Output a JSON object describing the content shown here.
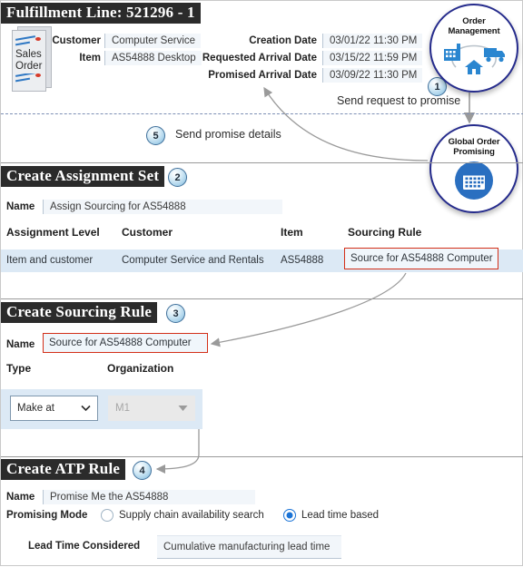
{
  "fulfillment": {
    "title": "Fulfillment Line: 521296 - 1",
    "doc_icon_label_line1": "Sales",
    "doc_icon_label_line2": "Order",
    "left_fields": [
      {
        "label": "Customer",
        "value": "Computer Service"
      },
      {
        "label": "Item",
        "value": "AS54888 Desktop"
      }
    ],
    "right_fields": [
      {
        "label": "Creation Date",
        "value": "03/01/22 11:30 PM"
      },
      {
        "label": "Requested Arrival Date",
        "value": "03/15/22 11:59 PM"
      },
      {
        "label": "Promised Arrival Date",
        "value": "03/09/22 11:30 PM"
      }
    ]
  },
  "steps": {
    "step1_number": "1",
    "step1_label": "Send request to promise",
    "step5_number": "5",
    "step5_label": "Send promise details"
  },
  "circles": {
    "order_management": {
      "line1": "Order",
      "line2": "Management",
      "icons": [
        "factory-icon",
        "truck-icon",
        "house-icon"
      ]
    },
    "global_order_promising": {
      "line1": "Global Order",
      "line2": "Promising",
      "icons": [
        "calendar-icon"
      ]
    }
  },
  "assignment_set": {
    "heading": "Create Assignment Set",
    "badge": "2",
    "name_label": "Name",
    "name_value": "Assign Sourcing for AS54888",
    "columns": [
      "Assignment Level",
      "Customer",
      "Item",
      "Sourcing Rule"
    ],
    "row": {
      "assignment_level": "Item and customer",
      "customer": "Computer Service and Rentals",
      "item": "AS54888",
      "sourcing_rule": "Source for AS54888 Computer"
    }
  },
  "sourcing_rule": {
    "heading": "Create Sourcing Rule",
    "badge": "3",
    "name_label": "Name",
    "name_value": "Source for AS54888 Computer",
    "columns": [
      "Type",
      "Organization"
    ],
    "type_value": "Make at",
    "organization_value": "M1"
  },
  "atp_rule": {
    "heading": "Create ATP Rule",
    "badge": "4",
    "name_label": "Name",
    "name_value": "Promise Me the AS54888",
    "promising_mode_label": "Promising Mode",
    "options": [
      {
        "label": "Supply chain availability search",
        "selected": false
      },
      {
        "label": "Lead time based",
        "selected": true
      }
    ],
    "lead_time_label": "Lead Time Considered",
    "lead_time_value": "Cumulative manufacturing lead time"
  },
  "colors": {
    "heading_band": "#2b2b2b",
    "circle_border": "#252b8c",
    "icon_blue": "#2a86d0",
    "row_blue": "#dce9f5",
    "highlight_red": "#d32f18",
    "radio_blue": "#1a73d6",
    "dashed_separator": "#7d8fb5"
  }
}
